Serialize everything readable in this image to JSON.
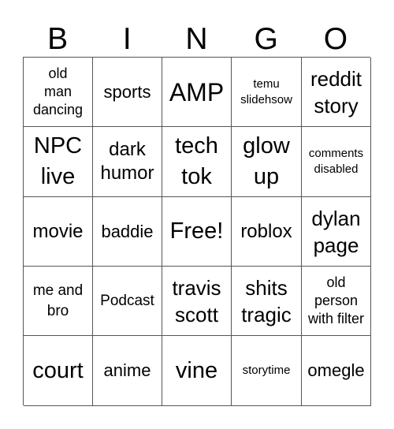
{
  "header": {
    "letters": [
      "B",
      "I",
      "N",
      "G",
      "O"
    ]
  },
  "card": {
    "rows": [
      [
        {
          "text": "old man dancing",
          "lines": [
            "old",
            "man",
            "dancing"
          ]
        },
        {
          "text": "sports",
          "lines": [
            "sports"
          ]
        },
        {
          "text": "AMP",
          "lines": [
            "AMP"
          ]
        },
        {
          "text": "temu slidehsow",
          "lines": [
            "temu",
            "slidehsow"
          ]
        },
        {
          "text": "reddit story",
          "lines": [
            "reddit",
            "story"
          ]
        }
      ],
      [
        {
          "text": "NPC live",
          "lines": [
            "NPC",
            "live"
          ]
        },
        {
          "text": "dark humor",
          "lines": [
            "dark",
            "humor"
          ]
        },
        {
          "text": "tech tok",
          "lines": [
            "tech",
            "tok"
          ]
        },
        {
          "text": "glow up",
          "lines": [
            "glow",
            "up"
          ]
        },
        {
          "text": "comments disabled",
          "lines": [
            "comments",
            "disabled"
          ]
        }
      ],
      [
        {
          "text": "movie",
          "lines": [
            "movie"
          ]
        },
        {
          "text": "baddie",
          "lines": [
            "baddie"
          ]
        },
        {
          "text": "Free!",
          "lines": [
            "Free!"
          ]
        },
        {
          "text": "roblox",
          "lines": [
            "roblox"
          ]
        },
        {
          "text": "dylan page",
          "lines": [
            "dylan",
            "page"
          ]
        }
      ],
      [
        {
          "text": "me and bro",
          "lines": [
            "me and",
            "bro"
          ]
        },
        {
          "text": "Podcast",
          "lines": [
            "Podcast"
          ]
        },
        {
          "text": "travis scott",
          "lines": [
            "travis",
            "scott"
          ]
        },
        {
          "text": "shits tragic",
          "lines": [
            "shits",
            "tragic"
          ]
        },
        {
          "text": "old person with filter",
          "lines": [
            "old",
            "person",
            "with filter"
          ]
        }
      ],
      [
        {
          "text": "court",
          "lines": [
            "court"
          ]
        },
        {
          "text": "anime",
          "lines": [
            "anime"
          ]
        },
        {
          "text": "vine",
          "lines": [
            "vine"
          ]
        },
        {
          "text": "storytime",
          "lines": [
            "storytime"
          ]
        },
        {
          "text": "omegle",
          "lines": [
            "omegle"
          ]
        }
      ]
    ],
    "free_space": "Free!"
  },
  "colors": {
    "grid_line": "#555555",
    "text": "#000000",
    "background": "#ffffff"
  }
}
